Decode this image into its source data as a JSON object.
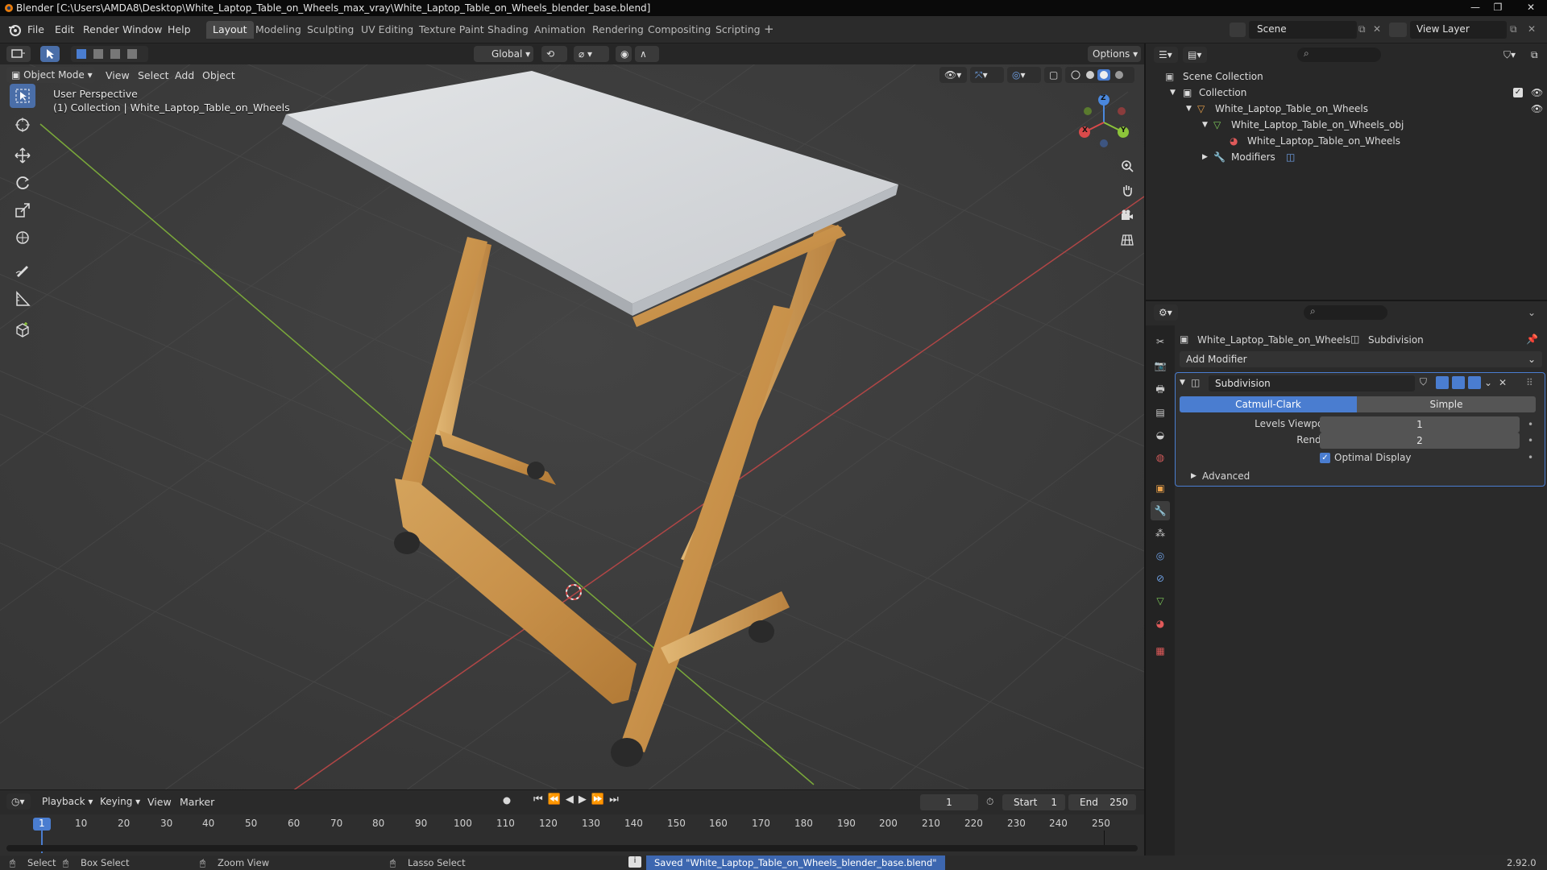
{
  "window": {
    "title": "Blender [C:\\Users\\AMDA8\\Desktop\\White_Laptop_Table_on_Wheels_max_vray\\White_Laptop_Table_on_Wheels_blender_base.blend]"
  },
  "menu": {
    "file": "File",
    "edit": "Edit",
    "render": "Render",
    "window": "Window",
    "help": "Help"
  },
  "workspaces": [
    "Layout",
    "Modeling",
    "Sculpting",
    "UV Editing",
    "Texture Paint",
    "Shading",
    "Animation",
    "Rendering",
    "Compositing",
    "Scripting"
  ],
  "active_workspace": "Layout",
  "scene_name": "Scene",
  "view_layer": "View Layer",
  "viewport_header": {
    "mode": "Object Mode",
    "view": "View",
    "select": "Select",
    "add": "Add",
    "object": "Object",
    "orientation": "Global",
    "options": "Options"
  },
  "viewport": {
    "perspective": "User Perspective",
    "collection_info": "(1) Collection | White_Laptop_Table_on_Wheels",
    "gizmo": {
      "x": "X",
      "y": "Y",
      "z": "Z"
    }
  },
  "timeline": {
    "playback": "Playback",
    "keying": "Keying",
    "view": "View",
    "marker": "Marker",
    "current_frame": "1",
    "start_label": "Start",
    "start": "1",
    "end_label": "End",
    "end": "250",
    "ticks": [
      "1",
      "10",
      "20",
      "30",
      "40",
      "50",
      "60",
      "70",
      "80",
      "90",
      "100",
      "110",
      "120",
      "130",
      "140",
      "150",
      "160",
      "170",
      "180",
      "190",
      "200",
      "210",
      "220",
      "230",
      "240",
      "250"
    ]
  },
  "outliner": {
    "scene_collection": "Scene Collection",
    "collection": "Collection",
    "object": "White_Laptop_Table_on_Wheels",
    "mesh": "White_Laptop_Table_on_Wheels_obj",
    "material": "White_Laptop_Table_on_Wheels",
    "modifiers": "Modifiers"
  },
  "properties": {
    "object_name": "White_Laptop_Table_on_Wheels",
    "modifier_context": "Subdivision",
    "add_modifier": "Add Modifier",
    "modifier_name": "Subdivision",
    "type_catmull": "Catmull-Clark",
    "type_simple": "Simple",
    "levels_viewport_label": "Levels Viewport",
    "levels_viewport": "1",
    "render_label": "Render",
    "render_value": "2",
    "optimal_display": "Optimal Display",
    "advanced": "Advanced"
  },
  "status": {
    "select": "Select",
    "box_select": "Box Select",
    "zoom_view": "Zoom View",
    "lasso_select": "Lasso Select",
    "message": "Saved \"White_Laptop_Table_on_Wheels_blender_base.blend\"",
    "version": "2.92.0"
  },
  "colors": {
    "accent": "#4a7dd0",
    "active_tool": "#4a6ea8",
    "x_axis": "#d94a4a",
    "y_axis": "#8cc43a",
    "z_axis": "#4a88dd"
  }
}
